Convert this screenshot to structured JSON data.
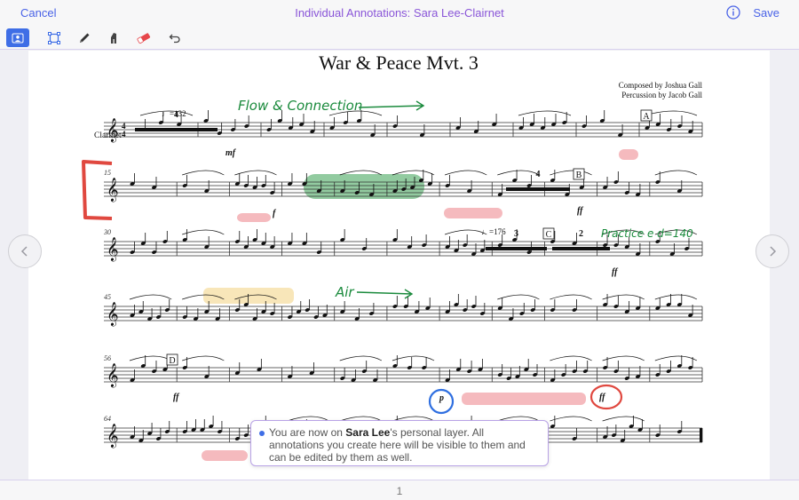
{
  "topbar": {
    "cancel_label": "Cancel",
    "title": "Individual Annotations: Sara Lee-Clairnet",
    "save_label": "Save"
  },
  "toolbar": {
    "tools": [
      {
        "icon": "person-layer-icon",
        "active": true
      },
      {
        "icon": "selection-icon",
        "active": false
      },
      {
        "icon": "pen-icon",
        "active": false
      },
      {
        "icon": "highlighter-icon",
        "active": false
      },
      {
        "icon": "eraser-icon",
        "active": false
      },
      {
        "icon": "undo-icon",
        "active": false
      }
    ]
  },
  "score": {
    "title": "War & Peace Mvt. 3",
    "composer": "Composed by Joshua Gall",
    "percussion": "Percussion by Jacob Gall",
    "instrument": "Clarinet",
    "tempo1": "=132",
    "tempo2": "=176",
    "rehearsal_marks": [
      "A",
      "B",
      "C",
      "D"
    ],
    "measure_numbers": [
      "15",
      "30",
      "45",
      "56",
      "64"
    ],
    "rest_counts": [
      "4",
      "4",
      "3",
      "2"
    ],
    "dynamics": [
      "mf",
      "f",
      "ff",
      "ff",
      "ff",
      "p",
      "ff"
    ],
    "time_signatures": [
      "4/4",
      "2/4",
      "4/4"
    ]
  },
  "annotations": {
    "flow_text": "Flow & Connection",
    "practice_text": "Practice e d=140",
    "air_text": "Air",
    "colors": {
      "green": "#1a8a3c",
      "red": "#e0483f",
      "blue": "#2f6fe0",
      "pink": "#f2a3a8",
      "green_highlight": "#4aa860",
      "yellow_highlight": "#f3d68a"
    }
  },
  "tooltip": {
    "prefix": "You are now on ",
    "name": "Sara Lee",
    "suffix": "'s personal layer. All annotations you create here will be visible to them and can be edited by them as well."
  },
  "footer": {
    "page_number": "1"
  },
  "accent_color": "#4a63e7"
}
